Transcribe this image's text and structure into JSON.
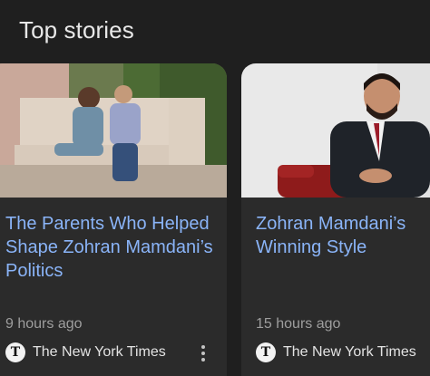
{
  "section": {
    "title": "Top stories"
  },
  "stories": [
    {
      "headline": "The Parents Who Helped Shape Zohran Mamdani’s Politics",
      "time": "9 hours ago",
      "source": "The New York Times",
      "source_logo": "T",
      "thumbnail": "photo-couple-on-bench-icon"
    },
    {
      "headline": "Zohran Mamdani’s Winning Style",
      "time": "15 hours ago",
      "source": "The New York Times",
      "source_logo": "T",
      "thumbnail": "photo-man-in-suit-icon"
    }
  ],
  "more_options": "more-vert-icon",
  "colors": {
    "background": "#1f1f1f",
    "card": "#2b2b2b",
    "headline": "#8ab4f8",
    "meta": "#9e9e9e"
  }
}
